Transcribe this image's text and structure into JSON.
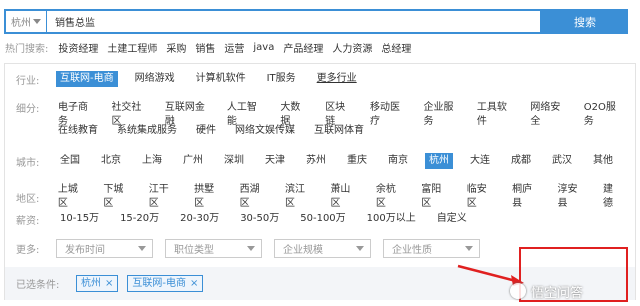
{
  "search": {
    "city": "杭州",
    "query": "销售总监",
    "button": "搜索"
  },
  "hot": {
    "label": "热门搜索:",
    "items": [
      "投资经理",
      "土建工程师",
      "采购",
      "销售",
      "运营",
      "java",
      "产品经理",
      "人力资源",
      "总经理"
    ]
  },
  "filters": {
    "industry": {
      "label": "行业:",
      "options": [
        "互联网-电商",
        "网络游戏",
        "计算机软件",
        "IT服务"
      ],
      "more": "更多行业",
      "active": "互联网-电商"
    },
    "subdivision": {
      "label": "细分:",
      "row1": [
        "电子商务",
        "社交社区",
        "互联网金融",
        "人工智能",
        "大数据",
        "区块链",
        "移动医疗",
        "企业服务",
        "工具软件",
        "网络安全",
        "O2O服务"
      ],
      "row2": [
        "在线教育",
        "系统集成服务",
        "硬件",
        "网络文娱传媒",
        "互联网体育"
      ]
    },
    "city": {
      "label": "城市:",
      "options": [
        "全国",
        "北京",
        "上海",
        "广州",
        "深圳",
        "天津",
        "苏州",
        "重庆",
        "南京",
        "杭州",
        "大连",
        "成都",
        "武汉",
        "其他"
      ],
      "active": "杭州"
    },
    "district": {
      "label": "地区:",
      "options": [
        "上城区",
        "下城区",
        "江干区",
        "拱墅区",
        "西湖区",
        "滨江区",
        "萧山区",
        "余杭区",
        "富阳区",
        "临安区",
        "桐庐县",
        "淳安县",
        "建德"
      ]
    },
    "salary": {
      "label": "薪资:",
      "options": [
        "10-15万",
        "15-20万",
        "20-30万",
        "30-50万",
        "50-100万",
        "100万以上",
        "自定义"
      ]
    },
    "more": {
      "label": "更多:",
      "dropdowns": [
        "发布时间",
        "职位类型",
        "企业规模",
        "企业性质"
      ]
    },
    "selected": {
      "label": "已选条件:",
      "tags": [
        "杭州",
        "互联网-电商"
      ],
      "remove": "×"
    }
  },
  "watermark": {
    "text": "悟空问答"
  },
  "colors": {
    "accent": "#3b8fd6",
    "annotation": "#e02020"
  }
}
